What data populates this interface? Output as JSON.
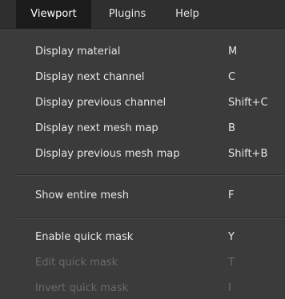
{
  "menubar": {
    "items": [
      {
        "label": "Viewport"
      },
      {
        "label": "Plugins"
      },
      {
        "label": "Help"
      }
    ]
  },
  "menu": {
    "items": [
      {
        "label": "Display material",
        "shortcut": "M"
      },
      {
        "label": "Display next channel",
        "shortcut": "C"
      },
      {
        "label": "Display previous channel",
        "shortcut": "Shift+C"
      },
      {
        "label": "Display next mesh map",
        "shortcut": "B"
      },
      {
        "label": "Display previous mesh map",
        "shortcut": "Shift+B"
      },
      {
        "label": "Show entire mesh",
        "shortcut": "F"
      },
      {
        "label": "Enable quick mask",
        "shortcut": "Y"
      },
      {
        "label": "Edit quick mask",
        "shortcut": "T"
      },
      {
        "label": "Invert quick mask",
        "shortcut": "I"
      }
    ]
  }
}
